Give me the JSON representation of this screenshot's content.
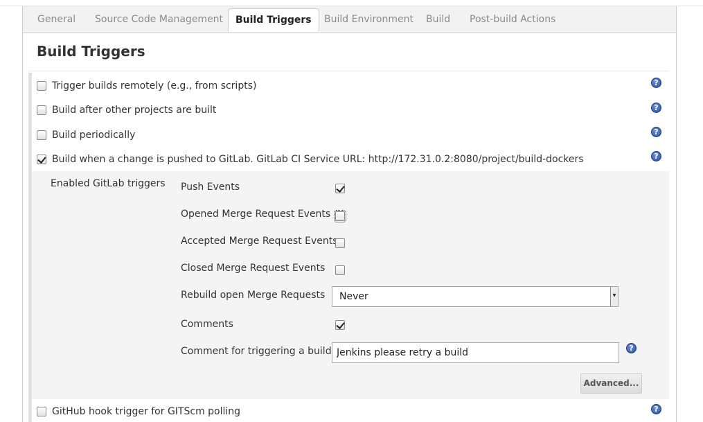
{
  "tabs": [
    {
      "label": "General",
      "active": false
    },
    {
      "label": "Source Code Management",
      "active": false
    },
    {
      "label": "Build Triggers",
      "active": true
    },
    {
      "label": "Build Environment",
      "active": false
    },
    {
      "label": "Build",
      "active": false
    },
    {
      "label": "Post-build Actions",
      "active": false
    }
  ],
  "section": {
    "title": "Build Triggers"
  },
  "triggers": [
    {
      "label": "Trigger builds remotely (e.g., from scripts)",
      "checked": false
    },
    {
      "label": "Build after other projects are built",
      "checked": false
    },
    {
      "label": "Build periodically",
      "checked": false
    },
    {
      "label": "Build when a change is pushed to GitLab. GitLab CI Service URL: http://172.31.0.2:8080/project/build-dockers",
      "checked": true
    },
    {
      "label": "GitHub hook trigger for GITScm polling",
      "checked": false
    }
  ],
  "gitlab": {
    "group_label": "Enabled GitLab triggers",
    "push_events": {
      "label": "Push Events",
      "checked": true
    },
    "opened_mr": {
      "label": "Opened Merge Request Events",
      "checked": false
    },
    "accepted_mr": {
      "label": "Accepted Merge Request Events",
      "checked": false
    },
    "closed_mr": {
      "label": "Closed Merge Request Events",
      "checked": false
    },
    "rebuild": {
      "label": "Rebuild open Merge Requests",
      "value": "Never"
    },
    "comments": {
      "label": "Comments",
      "checked": true
    },
    "comment_trigger": {
      "label": "Comment for triggering a build",
      "value": "Jenkins please retry a build"
    },
    "advanced_label": "Advanced..."
  },
  "help_glyph": "?",
  "colors": {
    "help_icon": "#2a4f9e",
    "active_tab_text": "#222222",
    "inactive_tab_text": "#8a8a8a"
  }
}
